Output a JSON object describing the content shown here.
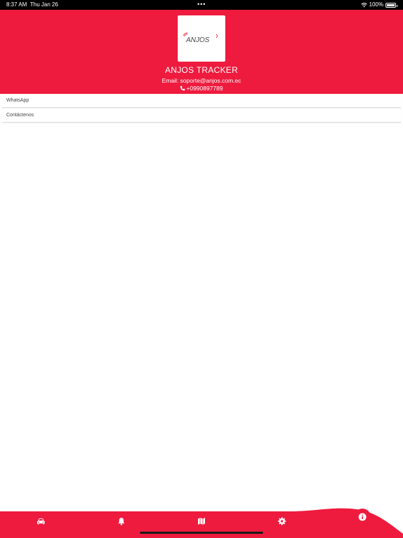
{
  "status_bar": {
    "time": "8:37 AM",
    "date": "Thu Jan 26",
    "battery": "100%",
    "battery_level": 1.0
  },
  "header": {
    "logo_text": "ANJOS",
    "title": "ANJOS TRACKER",
    "email": "Email: soporte@anjos.com.ec",
    "phone": "+0990897789"
  },
  "list": {
    "items": [
      {
        "label": "WhatsApp"
      },
      {
        "label": "Contáctenos"
      }
    ]
  },
  "bottom_nav": {
    "items": [
      {
        "icon": "car-icon"
      },
      {
        "icon": "bell-icon"
      },
      {
        "icon": "map-icon"
      },
      {
        "icon": "gear-icon"
      },
      {
        "icon": "info-icon",
        "active": true
      }
    ]
  },
  "colors": {
    "accent": "#ee1b3e",
    "background": "#ffffff"
  }
}
